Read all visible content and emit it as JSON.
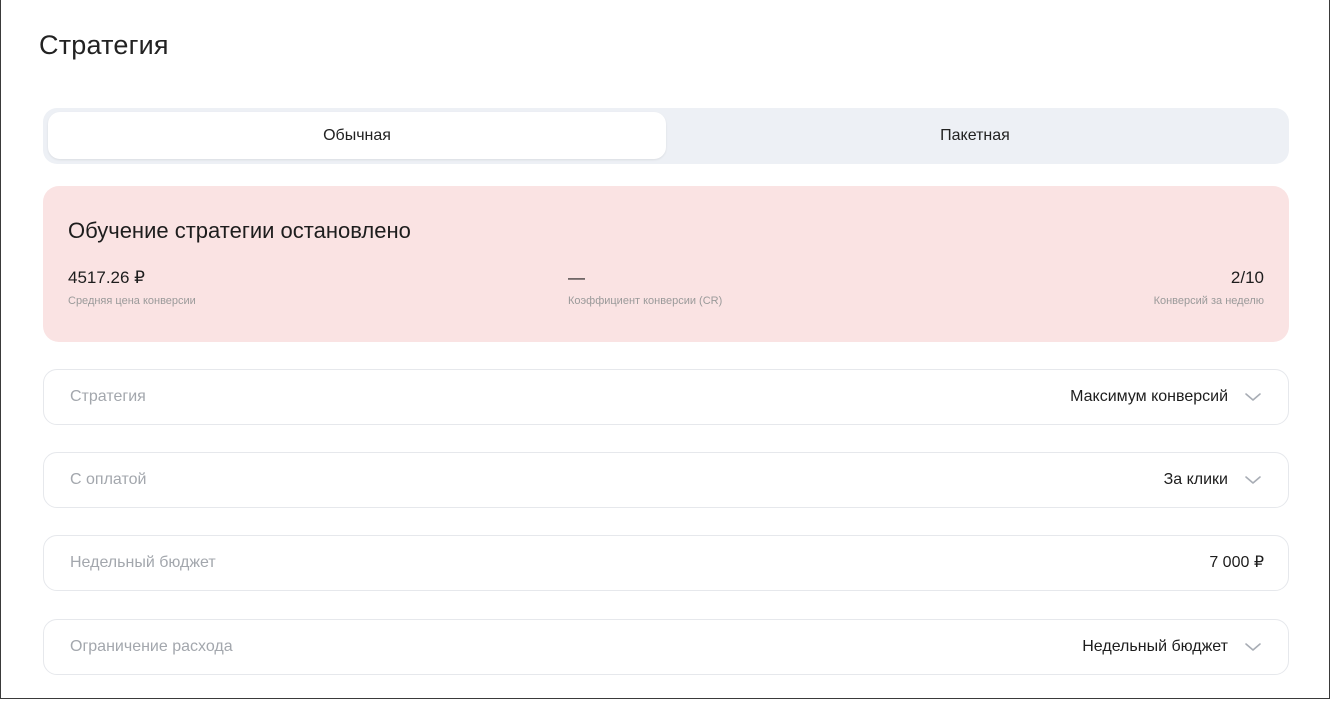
{
  "page": {
    "title": "Стратегия"
  },
  "tabs": [
    {
      "label": "Обычная",
      "active": true
    },
    {
      "label": "Пакетная",
      "active": false
    }
  ],
  "alert": {
    "title": "Обучение стратегии остановлено",
    "background": "#fae3e3",
    "metrics": [
      {
        "value": "4517.26 ₽",
        "label": "Средняя цена конверсии"
      },
      {
        "value": "—",
        "label": "Коэффициент конверсии (CR)"
      },
      {
        "value": "2/10",
        "label": "Конверсий за неделю"
      }
    ]
  },
  "fields": [
    {
      "label": "Стратегия",
      "value": "Максимум конверсий",
      "icon": "chevron-down-icon"
    },
    {
      "label": "С оплатой",
      "value": "За клики",
      "icon": "chevron-down-icon"
    },
    {
      "label": "Недельный бюджет",
      "value": "7 000 ₽"
    },
    {
      "label": "Ограничение расхода",
      "value": "Недельный бюджет",
      "icon": "chevron-down-icon"
    }
  ]
}
